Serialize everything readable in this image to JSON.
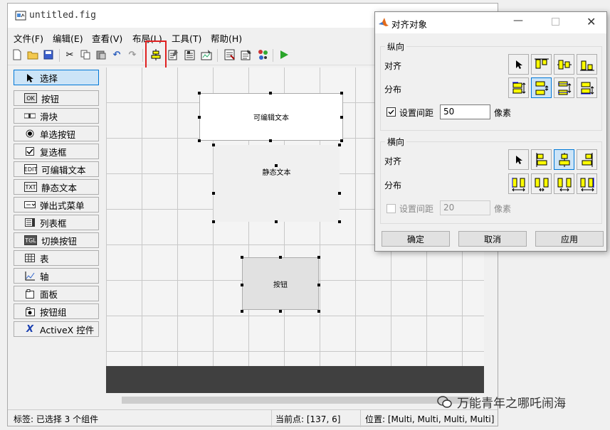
{
  "window": {
    "title": "untitled.fig"
  },
  "menu": [
    "文件(F)",
    "编辑(E)",
    "查看(V)",
    "布局(L)",
    "工具(T)",
    "帮助(H)"
  ],
  "toolbar": {
    "icons": [
      "new-file-icon",
      "open-folder-icon",
      "save-icon",
      "cut-icon",
      "copy-icon",
      "paste-icon",
      "undo-icon",
      "redo-icon",
      "align-objects-icon",
      "menu-editor-icon",
      "tab-order-icon",
      "toolbar-editor-icon",
      "mfile-editor-icon",
      "property-inspector-icon",
      "object-browser-icon",
      "run-icon"
    ]
  },
  "palette": {
    "items": [
      "选择",
      "按钮",
      "滑块",
      "单选按钮",
      "复选框",
      "可编辑文本",
      "静态文本",
      "弹出式菜单",
      "列表框",
      "切换按钮",
      "表",
      "轴",
      "面板",
      "按钮组",
      "ActiveX 控件"
    ]
  },
  "canvas": {
    "edit_text": "可编辑文本",
    "static_text": "静态文本",
    "push_button": "按钮"
  },
  "status": {
    "label": "标签: 已选择 3 个组件",
    "point": "当前点:  [137, 6]",
    "position": "位置: [Multi, Multi, Multi, Multi]"
  },
  "dialog": {
    "title": "对齐对象",
    "vertical_group": "纵向",
    "horizontal_group": "横向",
    "align_label": "对齐",
    "distribute_label": "分布",
    "spacing_label": "设置间距",
    "v_spacing_value": "50",
    "h_spacing_value": "20",
    "unit": "像素",
    "ok": "确定",
    "cancel": "取消",
    "apply": "应用"
  },
  "watermark": "万能青年之哪吒闹海",
  "colors": {
    "accent_blue": "#0078d7",
    "highlight_red": "#e02020",
    "selected_bg": "#cce4f7",
    "align_icon_yellow": "#ffff00"
  }
}
